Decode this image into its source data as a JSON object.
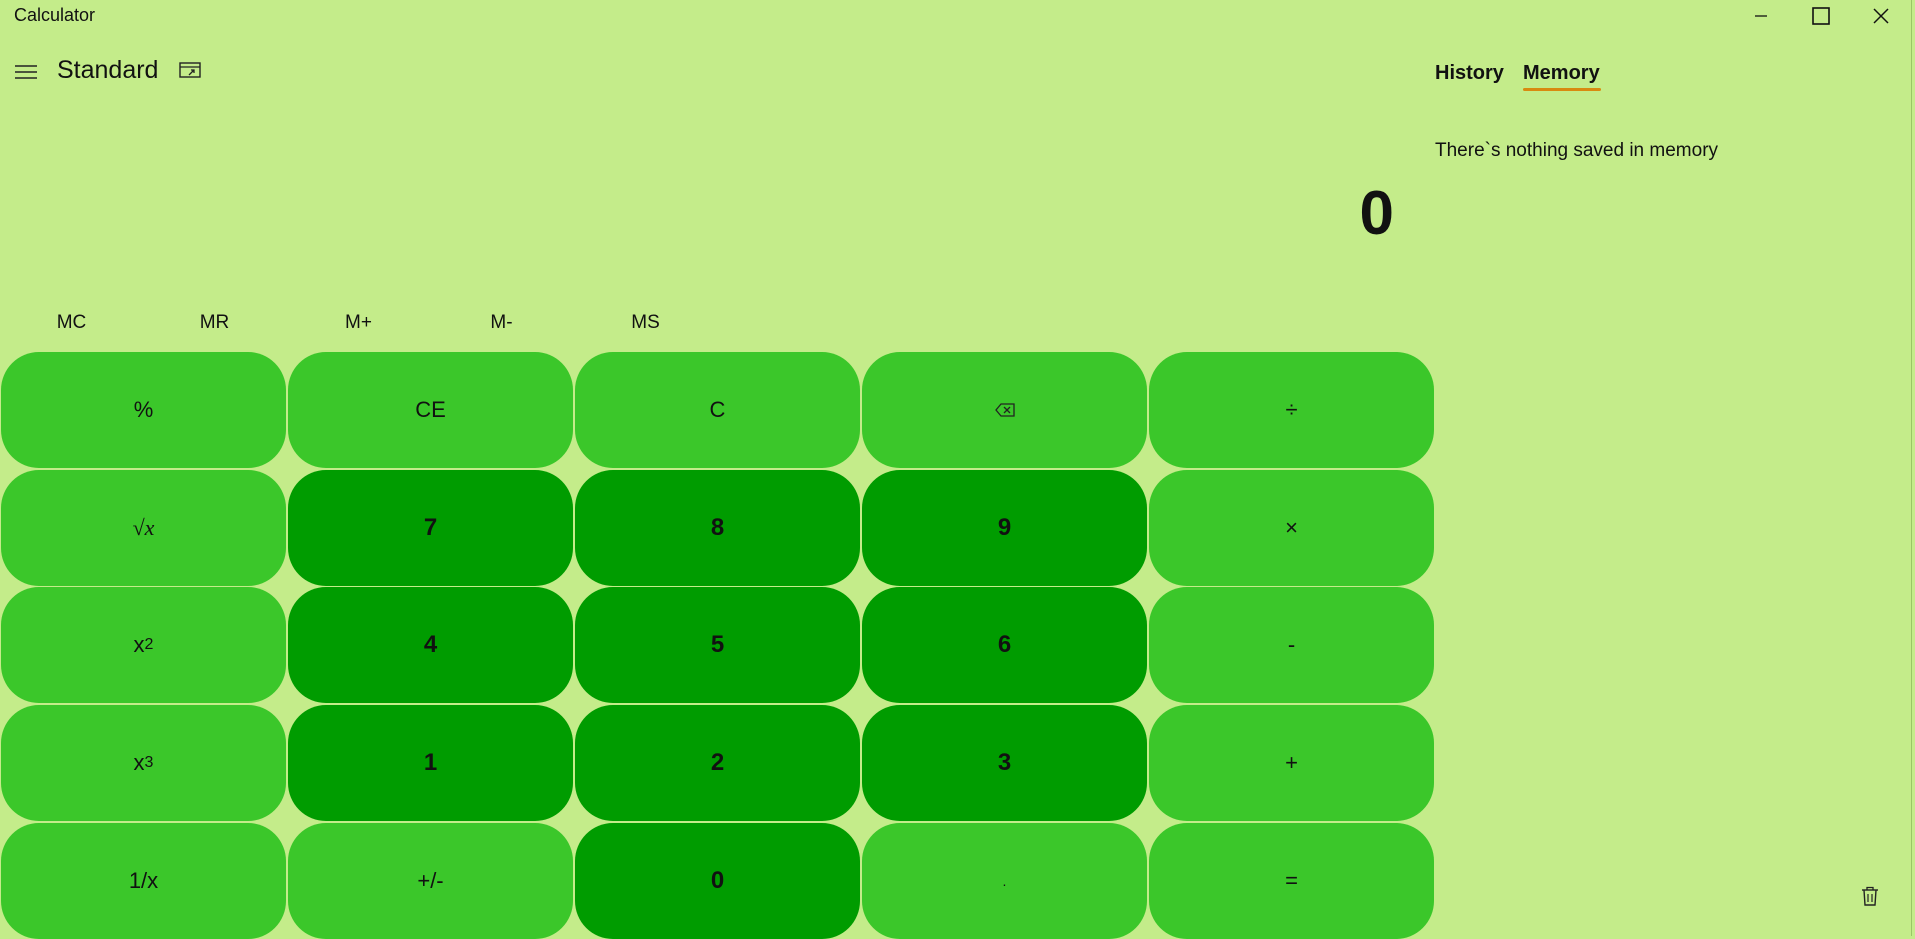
{
  "window": {
    "title": "Calculator"
  },
  "header": {
    "mode": "Standard"
  },
  "display": {
    "value": "0"
  },
  "memory_buttons": [
    "MC",
    "MR",
    "M+",
    "M-",
    "MS"
  ],
  "keys": {
    "percent": "%",
    "ce": "CE",
    "c": "C",
    "backspace": "backspace-icon",
    "divide": "÷",
    "sqrt": "√x",
    "seven": "7",
    "eight": "8",
    "nine": "9",
    "multiply": "×",
    "square_base": "x",
    "square_exp": "2",
    "four": "4",
    "five": "5",
    "six": "6",
    "minus": "-",
    "cube_base": "x",
    "cube_exp": "3",
    "one": "1",
    "two": "2",
    "three": "3",
    "plus": "+",
    "reciprocal": "1/x",
    "negate": "+/-",
    "zero": "0",
    "decimal": ".",
    "equals": "="
  },
  "side_panel": {
    "tabs": [
      "History",
      "Memory"
    ],
    "active_tab": "Memory",
    "empty_message": "There`s nothing saved in memory"
  },
  "colors": {
    "background": "#c4ec8a",
    "operator_key": "#3bc72a",
    "number_key": "#009c00",
    "tab_accent": "#d88a10"
  }
}
